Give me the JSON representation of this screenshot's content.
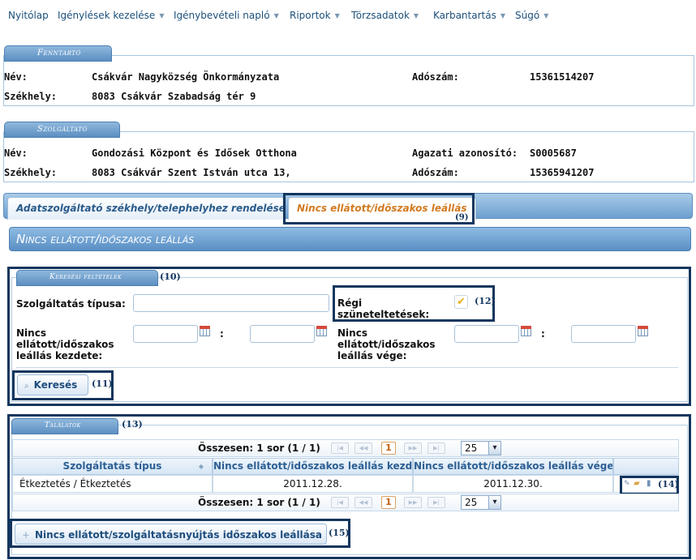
{
  "nav": {
    "items": [
      {
        "label": "Nyitólap",
        "has_caret": false
      },
      {
        "label": "Igénylések kezelése",
        "has_caret": true
      },
      {
        "label": "Igénybevételi napló",
        "has_caret": true
      },
      {
        "label": "Riportok",
        "has_caret": true
      },
      {
        "label": "Törzsadatok",
        "has_caret": true
      },
      {
        "label": "Karbantartás",
        "has_caret": true
      },
      {
        "label": "Súgó",
        "has_caret": true
      }
    ]
  },
  "fenntarto": {
    "legend": "Fenntartó",
    "nev_label": "Név:",
    "nev_value": "Csákvár Nagyközség Önkormányzata",
    "adoszam_label": "Adószám:",
    "adoszam_value": "15361514207",
    "szekhely_label": "Székhely:",
    "szekhely_value": "8083 Csákvár Szabadság tér 9"
  },
  "szolgaltato": {
    "legend": "Szolgáltató",
    "nev_label": "Név:",
    "nev_value": "Gondozási Központ és Idősek Otthona",
    "agazati_label": "Agazati azonosító:",
    "agazati_value": "S0005687",
    "szekhely_label": "Székhely:",
    "szekhely_value": "8083 Csákvár Szent István utca 13,",
    "adoszam_label": "Adószám:",
    "adoszam_value": "15365941207"
  },
  "tabs": [
    {
      "label": "Adatszolgáltató székhely/telephelyhez rendelése",
      "active": false
    },
    {
      "label": "Nincs ellátott/időszakos leállás",
      "active": true
    }
  ],
  "section_title": "Nincs ellátott/időszakos leállás",
  "search": {
    "legend": "Keresési feltételek",
    "service_type_label": "Szolgáltatás típusa:",
    "service_type_value": "",
    "old_suspensions_label_1": "Régi",
    "old_suspensions_label_2": "szüneteltetések:",
    "old_suspensions_checked": true,
    "start_label_1": "Nincs",
    "start_label_2": "ellátott/időszakos",
    "start_label_3": "leállás kezdete:",
    "end_label_1": "Nincs",
    "end_label_2": "ellátott/időszakos",
    "end_label_3": "leállás vége:",
    "range_separator": ":",
    "search_button": "Keresés"
  },
  "results": {
    "legend": "Találatok",
    "summary": "Összesen: 1 sor (1 / 1)",
    "current_page": "1",
    "page_size": "25",
    "columns": [
      "Szolgáltatás típus",
      "Nincs ellátott/időszakos leállás kezdete",
      "Nincs ellátott/időszakos leállás vége",
      ""
    ],
    "rows": [
      {
        "service_type": "Étkeztetés / Étkeztetés",
        "start": "2011.12.28.",
        "end": "2011.12.30."
      }
    ],
    "add_button": "Nincs ellátott/szolgáltatásnyújtás időszakos leállása"
  },
  "callouts": [
    "(9)",
    "(10)",
    "(11)",
    "(12)",
    "(13)",
    "(14)",
    "(15)"
  ],
  "colors": {
    "accent": "#5a8fc4",
    "active_tab_text": "#d27a20",
    "callout_border": "#12365e",
    "nav_text": "#1b4f7a"
  }
}
